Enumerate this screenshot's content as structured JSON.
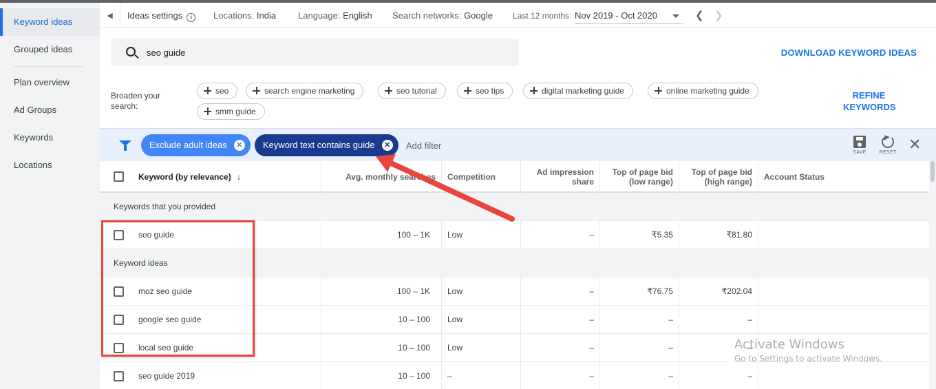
{
  "sidebar": {
    "items": [
      {
        "label": "Keyword ideas",
        "active": true
      },
      {
        "label": "Grouped ideas"
      },
      {
        "label": "Plan overview"
      },
      {
        "label": "Ad Groups"
      },
      {
        "label": "Keywords"
      },
      {
        "label": "Locations"
      }
    ]
  },
  "settings_bar": {
    "ideas_settings": "Ideas settings",
    "locations_label": "Locations:",
    "locations_value": "India",
    "language_label": "Language:",
    "language_value": "English",
    "networks_label": "Search networks:",
    "networks_value": "Google",
    "period_label": "Last 12 months",
    "date_range": "Nov 2019 - Oct 2020"
  },
  "search": {
    "query": "seo guide",
    "download_label": "DOWNLOAD KEYWORD IDEAS"
  },
  "broaden": {
    "label": "Broaden your search:",
    "chips": [
      "seo",
      "search engine marketing",
      "seo tutorial",
      "seo tips",
      "digital marketing guide",
      "online marketing guide",
      "smm guide"
    ],
    "refine_label": "REFINE KEYWORDS"
  },
  "filter_bar": {
    "chips": [
      "Exclude adult ideas",
      "Keyword text contains guide"
    ],
    "add_filter": "Add filter",
    "save_label": "SAVE",
    "reset_label": "RESET"
  },
  "table": {
    "headers": {
      "keyword": "Keyword (by relevance)",
      "searches": "Avg. monthly searches",
      "competition": "Competition",
      "impression_1": "Ad impression",
      "impression_2": "share",
      "low_bid_1": "Top of page bid",
      "low_bid_2": "(low range)",
      "high_bid_1": "Top of page bid",
      "high_bid_2": "(high range)",
      "account_status": "Account Status"
    },
    "provided_section": "Keywords that you provided",
    "ideas_section": "Keyword ideas",
    "provided_rows": [
      {
        "keyword": "seo guide",
        "searches": "100 – 1K",
        "competition": "Low",
        "impression": "–",
        "low_bid": "₹5.35",
        "high_bid": "₹81.80"
      }
    ],
    "idea_rows": [
      {
        "keyword": "moz seo guide",
        "searches": "100 – 1K",
        "competition": "Low",
        "impression": "–",
        "low_bid": "₹76.75",
        "high_bid": "₹202.04"
      },
      {
        "keyword": "google seo guide",
        "searches": "10 – 100",
        "competition": "Low",
        "impression": "–",
        "low_bid": "–",
        "high_bid": "–"
      },
      {
        "keyword": "local seo guide",
        "searches": "10 – 100",
        "competition": "Low",
        "impression": "–",
        "low_bid": "–",
        "high_bid": "–"
      },
      {
        "keyword": "seo guide 2019",
        "searches": "10 – 100",
        "competition": "–",
        "impression": "–",
        "low_bid": "–",
        "high_bid": "–"
      }
    ]
  },
  "watermark": {
    "line1": "Activate Windows",
    "line2": "Go to Settings to activate Windows."
  },
  "colors": {
    "accent": "#1a73e8",
    "annotation": "#e8453c",
    "filter_chip_dark": "#1a3a8f",
    "filter_bar_bg": "#e8f0fe"
  }
}
